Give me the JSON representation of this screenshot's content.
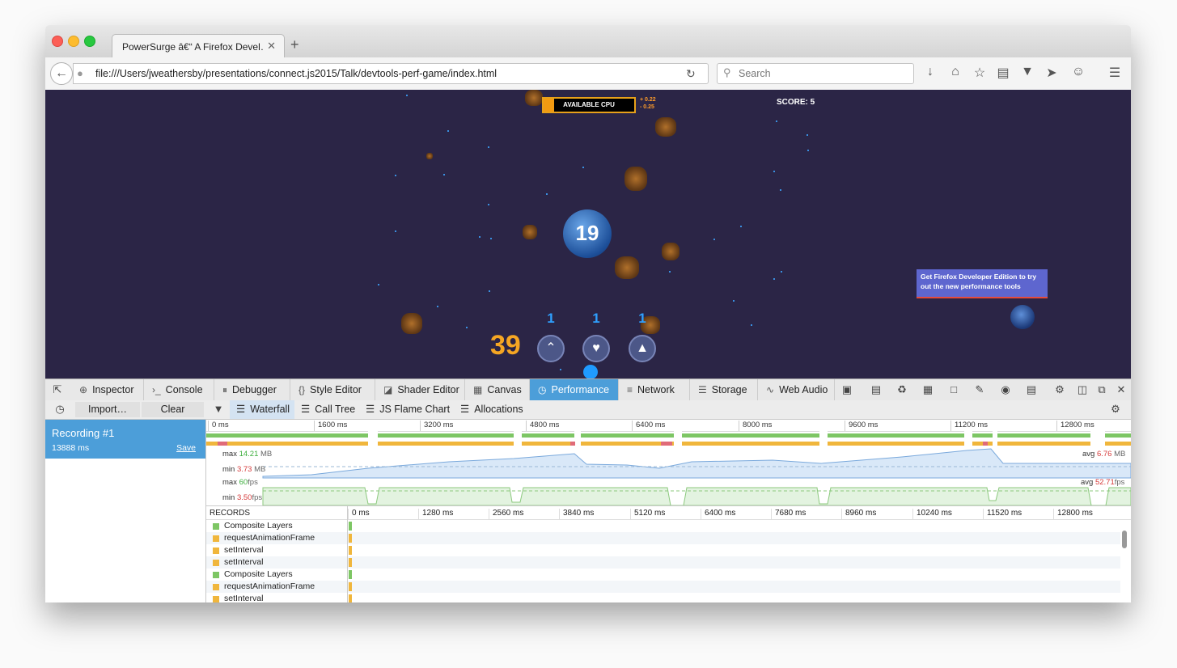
{
  "browser": {
    "tab_title": "PowerSurge â€“ A Firefox Devel…",
    "tab_close": "✕",
    "new_tab": "+",
    "url": "file:///Users/jweathersby/presentations/connect.js2015/Talk/devtools-perf-game/index.html",
    "search_placeholder": "Search"
  },
  "game": {
    "cpu_label": "AVAILABLE CPU",
    "cpu_fraction": 0.12,
    "cpu_delta_up": "+ 0.22",
    "cpu_delta_down": "- 0.25",
    "score": "SCORE: 5",
    "planet_number": "19",
    "tooltip": "Get Firefox Developer Edition to try out the new performance tools",
    "big_number": "39",
    "powerups": [
      {
        "count": "1",
        "icon": "rank-chevrons-icon",
        "glyph": "⌃"
      },
      {
        "count": "1",
        "icon": "heart-icon",
        "glyph": "♥"
      },
      {
        "count": "1",
        "icon": "rocket-icon",
        "glyph": "▲"
      }
    ]
  },
  "devtools": {
    "tabs": [
      {
        "label": "Inspector",
        "icon": "inspector-icon",
        "glyph": "⊕"
      },
      {
        "label": "Console",
        "icon": "console-icon",
        "glyph": "›_"
      },
      {
        "label": "Debugger",
        "icon": "debugger-icon",
        "glyph": "⏸"
      },
      {
        "label": "Style Editor",
        "icon": "style-editor-icon",
        "glyph": "{}"
      },
      {
        "label": "Shader Editor",
        "icon": "shader-editor-icon",
        "glyph": "◪"
      },
      {
        "label": "Canvas",
        "icon": "canvas-icon",
        "glyph": "▦"
      },
      {
        "label": "Performance",
        "icon": "performance-icon",
        "glyph": "◷",
        "active": true
      },
      {
        "label": "Network",
        "icon": "network-icon",
        "glyph": "≡"
      },
      {
        "label": "Storage",
        "icon": "storage-icon",
        "glyph": "☰"
      },
      {
        "label": "Web Audio",
        "icon": "web-audio-icon",
        "glyph": "∿"
      }
    ]
  },
  "perf": {
    "import_label": "Import…",
    "clear_label": "Clear",
    "views": [
      {
        "label": "Waterfall",
        "active": true
      },
      {
        "label": "Call Tree"
      },
      {
        "label": "JS Flame Chart"
      },
      {
        "label": "Allocations"
      }
    ],
    "recording": {
      "title": "Recording #1",
      "duration": "13888 ms",
      "save_label": "Save"
    },
    "overview_ticks": [
      "0 ms",
      "1600 ms",
      "3200 ms",
      "4800 ms",
      "6400 ms",
      "8000 ms",
      "9600 ms",
      "11200 ms",
      "12800 ms"
    ],
    "memory": {
      "max_label": "max",
      "max_value": "14.21",
      "min_label": "min",
      "min_value": "3.73",
      "avg_label": "avg",
      "avg_value": "6.76",
      "unit": "MB"
    },
    "fps": {
      "max_label": "max",
      "max_value": "60",
      "min_label": "min",
      "min_value": "3.50",
      "avg_label": "avg",
      "avg_value": "52.71",
      "unit": "fps"
    },
    "records_header": "RECORDS",
    "waterfall_ticks": [
      "0 ms",
      "1280 ms",
      "2560 ms",
      "3840 ms",
      "5120 ms",
      "6400 ms",
      "7680 ms",
      "8960 ms",
      "10240 ms",
      "11520 ms",
      "12800 ms"
    ],
    "records": [
      {
        "name": "Composite Layers",
        "color": "#7dc664"
      },
      {
        "name": "requestAnimationFrame",
        "color": "#f0b63c"
      },
      {
        "name": "setInterval",
        "color": "#f0b63c"
      },
      {
        "name": "setInterval",
        "color": "#f0b63c"
      },
      {
        "name": "Composite Layers",
        "color": "#7dc664"
      },
      {
        "name": "requestAnimationFrame",
        "color": "#f0b63c"
      },
      {
        "name": "setInterval",
        "color": "#f0b63c"
      }
    ]
  }
}
